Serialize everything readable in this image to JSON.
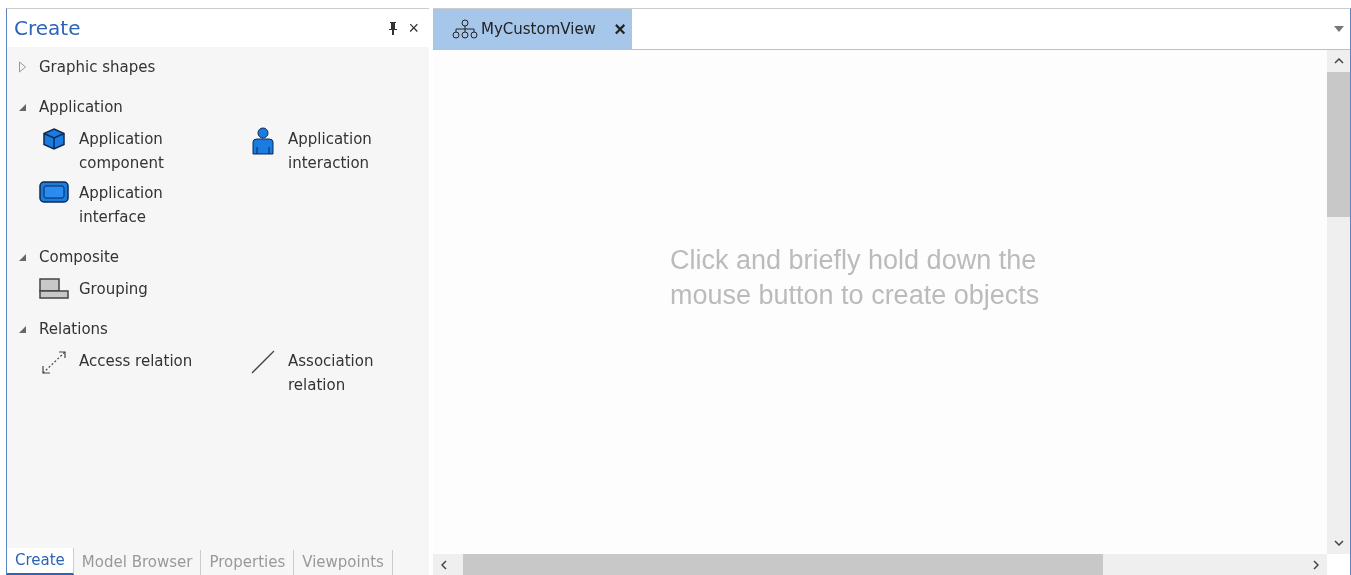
{
  "panel": {
    "title": "Create",
    "close": "×"
  },
  "sections": [
    {
      "label": "Graphic shapes",
      "expanded": false
    },
    {
      "label": "Application",
      "expanded": true,
      "items": [
        {
          "kind": "component",
          "label": "Application component"
        },
        {
          "kind": "interaction",
          "label": "Application interaction"
        },
        {
          "kind": "interface",
          "label": "Application interface"
        }
      ]
    },
    {
      "label": "Composite",
      "expanded": true,
      "items": [
        {
          "kind": "grouping",
          "label": "Grouping"
        }
      ]
    },
    {
      "label": "Relations",
      "expanded": true,
      "items": [
        {
          "kind": "access",
          "label": "Access relation"
        },
        {
          "kind": "association",
          "label": "Association relation"
        }
      ]
    }
  ],
  "bottom_tabs": [
    {
      "label": "Create",
      "selected": true
    },
    {
      "label": "Model Browser",
      "selected": false
    },
    {
      "label": "Properties",
      "selected": false
    },
    {
      "label": "Viewpoints",
      "selected": false
    }
  ],
  "document_tab": {
    "label": "MyCustomView",
    "close": "×",
    "selected": true
  },
  "canvas": {
    "hint": "Click and briefly hold down the mouse button to create objects"
  }
}
